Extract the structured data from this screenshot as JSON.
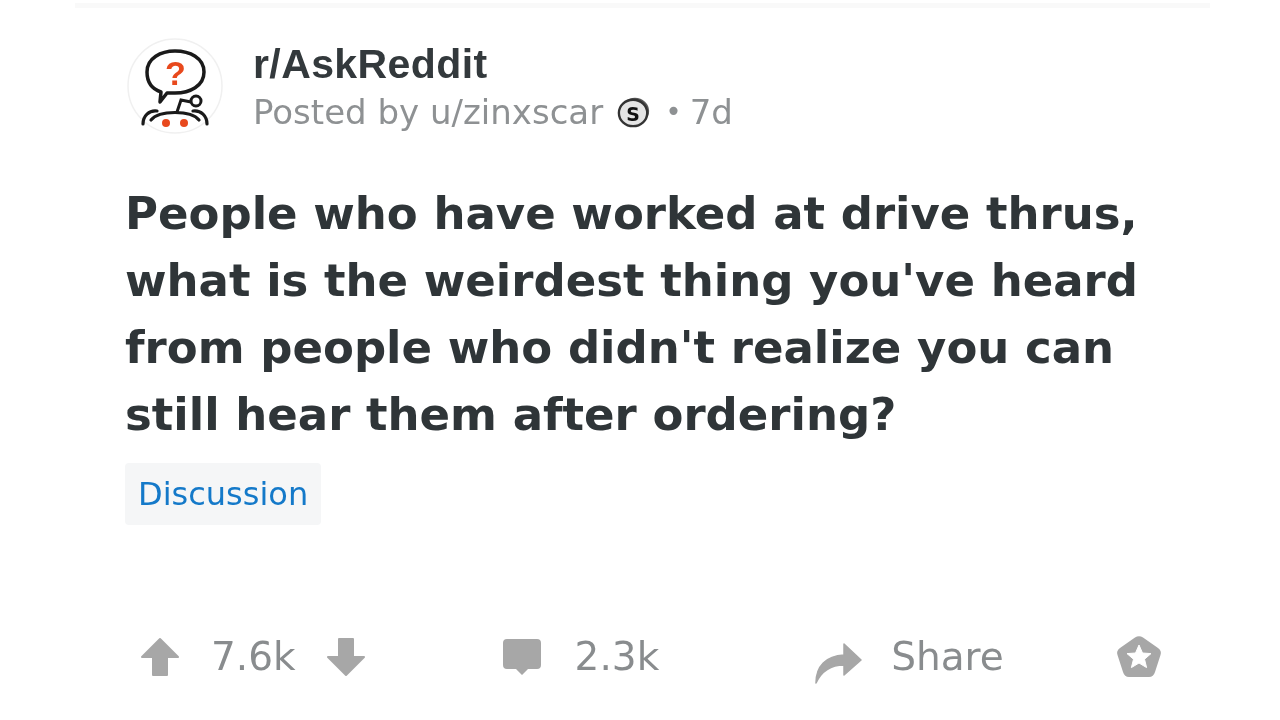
{
  "post": {
    "subreddit": "r/AskReddit",
    "avatar_glyph": "?",
    "posted_by": "Posted by u/zinxscar",
    "user_badge_glyph": "S",
    "separator": "•",
    "age": "7d",
    "title": "People who have worked at drive thrus, what is the weirdest thing you've heard from people who didn't realize you can still hear them after ordering?",
    "flair": "Discussion"
  },
  "actions": [
    {
      "kind": "vote",
      "score": "7.6k"
    },
    {
      "kind": "comments",
      "count": "2.3k"
    },
    {
      "kind": "share",
      "label": "Share"
    },
    {
      "kind": "award"
    }
  ]
}
